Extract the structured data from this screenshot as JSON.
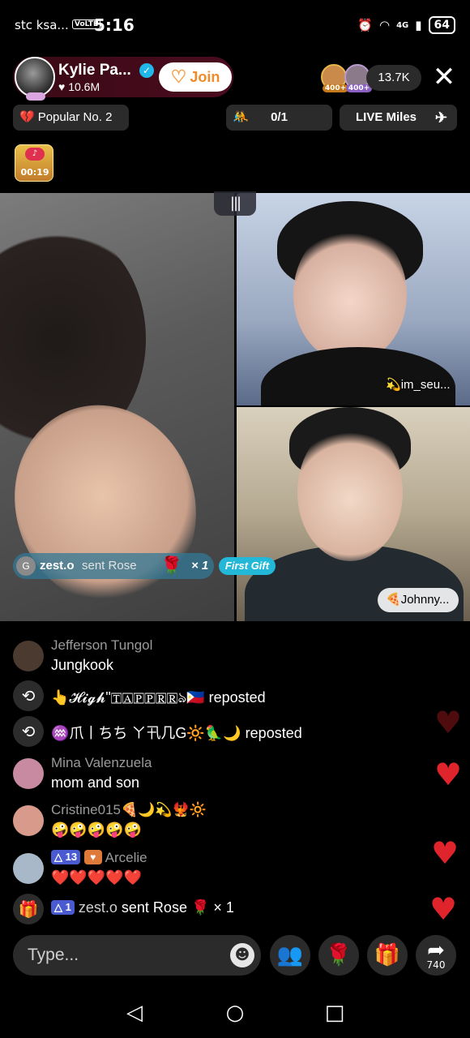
{
  "status_bar": {
    "carrier": "stc ksa...",
    "volte": "VoLTE",
    "time": "5:16",
    "network": "4G",
    "battery": "64"
  },
  "host": {
    "name": "Kylie Pa...",
    "likes": "10.6M",
    "join_label": "Join"
  },
  "viewers": {
    "badges": [
      "400+",
      "400+"
    ],
    "count": "13.7K"
  },
  "pills": {
    "popular": "Popular No. 2",
    "score": "0/1",
    "miles": "LIVE Miles"
  },
  "treasure": {
    "timer": "00:19"
  },
  "guests": {
    "top_name": "im_seu...",
    "bottom_name": "Johnny..."
  },
  "gift_toast": {
    "avatar_letter": "G",
    "user": "zest.o",
    "action": "sent Rose",
    "multiplier": "× 1",
    "first_gift": "First Gift"
  },
  "chat": [
    {
      "type": "comment",
      "name": "Jefferson Tungol",
      "message": "Jungkook"
    },
    {
      "type": "repost",
      "name": "👆𝓗𝓲𝓰𝓱\"🅃🄰🄿🄿🅁🅁ঌ🇵🇭",
      "action": "reposted"
    },
    {
      "type": "repost",
      "name": "♒爪丨ちち ㄚ卂几G🔆🦜🌙",
      "action": "reposted"
    },
    {
      "type": "comment",
      "name": "Mina Valenzuela",
      "message": "mom and son"
    },
    {
      "type": "comment",
      "name": "Cristine015🍕🌙💫🐦‍🔥🔆",
      "message": "🤪🤪🤪🤪🤪"
    },
    {
      "type": "comment",
      "name": "Arcelie",
      "level": "13",
      "message": "❤️❤️❤️❤️❤️"
    },
    {
      "type": "gift",
      "level": "1",
      "user": "zest.o",
      "action": "sent Rose 🌹 × 1"
    }
  ],
  "input": {
    "placeholder": "Type..."
  },
  "actions": {
    "share_count": "740"
  },
  "colors": {
    "accent_heart": "#e0242c",
    "join_text": "#f08a2a",
    "first_gift_bg": "#23b8d8",
    "host_capsule": "#4a0b1e"
  }
}
